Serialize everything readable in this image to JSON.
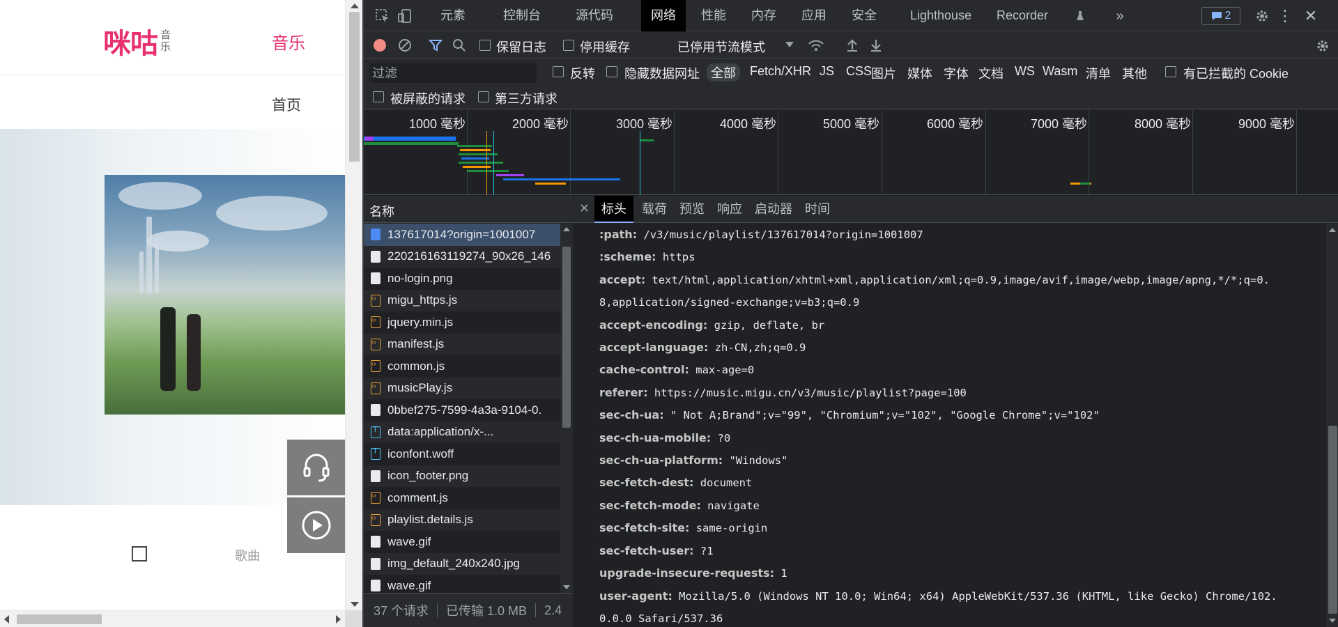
{
  "webpage": {
    "logo_main": "咪咕",
    "logo_sub_1": "音",
    "logo_sub_2": "乐",
    "nav_music": "音乐",
    "nav_home": "首页",
    "song_label": "歌曲"
  },
  "devtools": {
    "tabs": [
      "元素",
      "控制台",
      "源代码",
      "网络",
      "性能",
      "内存",
      "应用",
      "安全",
      "Lighthouse",
      "Recorder"
    ],
    "active_tab": "网络",
    "issues_count": "2",
    "toolbar": {
      "preserve_log": "保留日志",
      "disable_cache": "停用缓存",
      "throttle": "已停用节流模式"
    },
    "filter": {
      "placeholder": "过滤",
      "invert": "反转",
      "hide_data_urls": "隐藏数据网址",
      "types": [
        "全部",
        "Fetch/XHR",
        "JS",
        "CSS",
        "图片",
        "媒体",
        "字体",
        "文档",
        "WS",
        "Wasm",
        "清单",
        "其他"
      ],
      "active_type": "全部",
      "blocked_cookies": "有已拦截的 Cookie",
      "blocked_requests": "被屏蔽的请求",
      "third_party": "第三方请求"
    },
    "timeline": {
      "labels": [
        "1000 毫秒",
        "2000 毫秒",
        "3000 毫秒",
        "4000 毫秒",
        "5000 毫秒",
        "6000 毫秒",
        "7000 毫秒",
        "8000 毫秒",
        "9000 毫秒"
      ]
    },
    "requests": {
      "column_name": "名称",
      "items": [
        {
          "name": "137617014?origin=1001007",
          "type": "doc"
        },
        {
          "name": "220216163119274_90x26_146",
          "type": "img"
        },
        {
          "name": "no-login.png",
          "type": "img"
        },
        {
          "name": "migu_https.js",
          "type": "js"
        },
        {
          "name": "jquery.min.js",
          "type": "js"
        },
        {
          "name": "manifest.js",
          "type": "js"
        },
        {
          "name": "common.js",
          "type": "js"
        },
        {
          "name": "musicPlay.js",
          "type": "js"
        },
        {
          "name": "0bbef275-7599-4a3a-9104-0.",
          "type": "img"
        },
        {
          "name": "data:application/x-...",
          "type": "font"
        },
        {
          "name": "iconfont.woff",
          "type": "font"
        },
        {
          "name": "icon_footer.png",
          "type": "img"
        },
        {
          "name": "comment.js",
          "type": "js"
        },
        {
          "name": "playlist.details.js",
          "type": "js"
        },
        {
          "name": "wave.gif",
          "type": "img"
        },
        {
          "name": "img_default_240x240.jpg",
          "type": "img"
        },
        {
          "name": "wave.gif",
          "type": "img"
        }
      ],
      "status": {
        "count": "37 个请求",
        "transferred": "已传输 1.0 MB",
        "extra": "2.4"
      }
    },
    "detail": {
      "tabs": [
        "标头",
        "载荷",
        "预览",
        "响应",
        "启动器",
        "时间"
      ],
      "active_tab": "标头",
      "headers": [
        {
          "k": ":path:",
          "v": " /v3/music/playlist/137617014?origin=1001007"
        },
        {
          "k": ":scheme:",
          "v": " https"
        },
        {
          "k": "accept:",
          "v": " text/html,application/xhtml+xml,application/xml;q=0.9,image/avif,image/webp,image/apng,*/*;q=0."
        },
        {
          "k": "",
          "v": "8,application/signed-exchange;v=b3;q=0.9"
        },
        {
          "k": "accept-encoding:",
          "v": " gzip, deflate, br"
        },
        {
          "k": "accept-language:",
          "v": " zh-CN,zh;q=0.9"
        },
        {
          "k": "cache-control:",
          "v": " max-age=0"
        },
        {
          "k": "referer:",
          "v": " https://music.migu.cn/v3/music/playlist?page=100"
        },
        {
          "k": "sec-ch-ua:",
          "v": " \" Not A;Brand\";v=\"99\", \"Chromium\";v=\"102\", \"Google Chrome\";v=\"102\""
        },
        {
          "k": "sec-ch-ua-mobile:",
          "v": " ?0"
        },
        {
          "k": "sec-ch-ua-platform:",
          "v": " \"Windows\""
        },
        {
          "k": "sec-fetch-dest:",
          "v": " document"
        },
        {
          "k": "sec-fetch-mode:",
          "v": " navigate"
        },
        {
          "k": "sec-fetch-site:",
          "v": " same-origin"
        },
        {
          "k": "sec-fetch-user:",
          "v": " ?1"
        },
        {
          "k": "upgrade-insecure-requests:",
          "v": " 1"
        },
        {
          "k": "user-agent:",
          "v": " Mozilla/5.0 (Windows NT 10.0; Win64; x64) AppleWebKit/537.36 (KHTML, like Gecko) Chrome/102."
        },
        {
          "k": "",
          "v": "0.0.0 Safari/537.36"
        }
      ]
    }
  },
  "colors": {
    "brand_pink": "#e8326e",
    "devtools_bg": "#202124",
    "record_red": "#f28b82",
    "link_blue": "#8ab4f8"
  }
}
